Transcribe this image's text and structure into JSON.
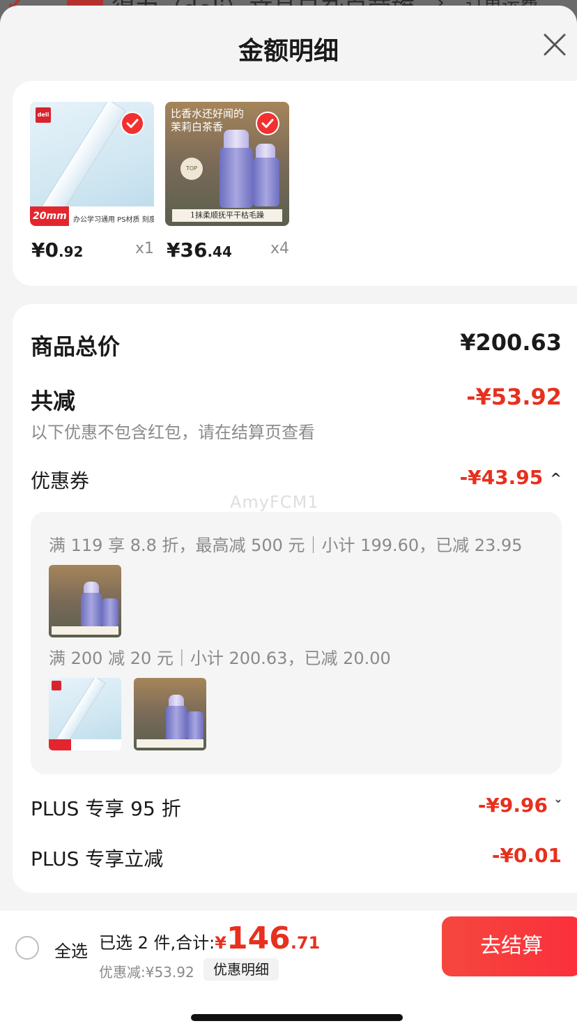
{
  "background": {
    "title": "得力（deli）文具日杂自营旗",
    "right_text": "订单运费"
  },
  "sheet": {
    "title": "金额明细",
    "close_icon": "close-icon"
  },
  "products": [
    {
      "price_int": "¥0",
      "price_dec": ".92",
      "qty": "x1",
      "thumb": "ruler",
      "badge_text": "20mm",
      "band_text": "办公学习通用  PS材质  刻度清晰",
      "brand": "deli"
    },
    {
      "price_int": "¥36",
      "price_dec": ".44",
      "qty": "x4",
      "thumb": "perfume",
      "headline": "比香水还好闻的\n茉莉白茶香",
      "band_text": "1抹柔顺抚平干枯毛躁"
    }
  ],
  "details": {
    "total_label": "商品总价",
    "total_value": "¥200.63",
    "reduce_label": "共减",
    "reduce_value": "-¥53.92",
    "reduce_note": "以下优惠不包含红包，请在结算页查看",
    "coupon_label": "优惠券",
    "coupon_value": "-¥43.95",
    "coupon_chevron": "^",
    "watermark": "AmyFCM1",
    "coupon_rules": [
      "满 119 享 8.8 折，最高减 500 元｜小计 199.60，已减 23.95",
      "满 200 减 20 元｜小计 200.63，已减 20.00"
    ],
    "plus1_label": "PLUS 专享 95 折",
    "plus1_value": "-¥9.96",
    "plus1_chevron": "ˇ",
    "plus2_label": "PLUS 专享立减",
    "plus2_value": "-¥0.01"
  },
  "footer": {
    "select_all": "全选",
    "selected_text": "已选 2 件,合计:",
    "total_currency": "¥",
    "total_int": "146",
    "total_dec": ".71",
    "discount_text": "优惠减:¥53.92",
    "detail_button": "优惠明细",
    "checkout_button": "去结算"
  },
  "colors": {
    "accent_red": "#e8301e",
    "checkout_start": "#f5473e",
    "checkout_end": "#fb2f3b"
  }
}
